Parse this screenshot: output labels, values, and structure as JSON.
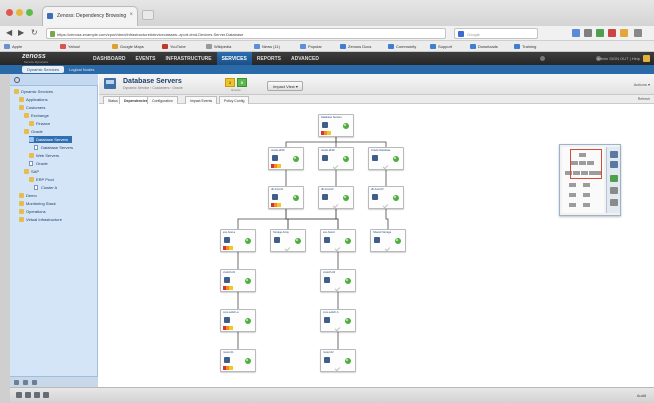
{
  "browser": {
    "tab_title": "Zenoss: Dependency Browsing",
    "tab_close": "×",
    "url": "https://zenoss.example.com/zport/dmd/infrastructure#deviceclasses:.zport.dmd.Devices.Server.Database",
    "search_placeholder": "Google",
    "back": "◀",
    "forward": "▶",
    "reload": "↻"
  },
  "bookmarks": [
    "Apple",
    "Yahoo!",
    "Google Maps",
    "YouTube",
    "Wikipedia",
    "News (11)",
    "Popular",
    "Zenoss Docs",
    "Community",
    "Support",
    "Downloads",
    "Training"
  ],
  "app": {
    "logo": "zenoss",
    "logo_sub": "Service Dynamics",
    "nav": [
      "DASHBOARD",
      "EVENTS",
      "INFRASTRUCTURE",
      "SERVICES",
      "REPORTS",
      "ADVANCED"
    ],
    "active_nav": 3,
    "head_right": "admin  SIGN OUT  |  Help",
    "subtabs": [
      "Dynamic Services",
      "Logical Nodes"
    ]
  },
  "tree": {
    "items": [
      {
        "label": "Dynamic Services",
        "level": 0,
        "type": "folder"
      },
      {
        "label": "Applications",
        "level": 1,
        "type": "folder"
      },
      {
        "label": "Customers",
        "level": 1,
        "type": "folder"
      },
      {
        "label": "Exchange",
        "level": 2,
        "type": "folder"
      },
      {
        "label": "Finance",
        "level": 3,
        "type": "folder"
      },
      {
        "label": "Oracle",
        "level": 2,
        "type": "folder"
      },
      {
        "label": "Database Servers",
        "level": 3,
        "type": "folder",
        "selected": true
      },
      {
        "label": "Database Servers",
        "level": 4,
        "type": "doc"
      },
      {
        "label": "Web Servers",
        "level": 3,
        "type": "folder"
      },
      {
        "label": "Oracle",
        "level": 3,
        "type": "doc"
      },
      {
        "label": "SAP",
        "level": 2,
        "type": "folder"
      },
      {
        "label": "ERP Prod",
        "level": 3,
        "type": "folder"
      },
      {
        "label": "Cluster A",
        "level": 4,
        "type": "doc"
      },
      {
        "label": "Demo",
        "level": 1,
        "type": "folder"
      },
      {
        "label": "Monitoring Stack",
        "level": 1,
        "type": "folder"
      },
      {
        "label": "Operations",
        "level": 1,
        "type": "folder"
      },
      {
        "label": "Virtual Infrastructure",
        "level": 1,
        "type": "folder"
      }
    ]
  },
  "main": {
    "title": "Database Servers",
    "subtitle": "Dynamic Service › Customers › Oracle",
    "sev_yellow": "1",
    "sev_green": "0",
    "sev_label": "Events",
    "impact_button": "Impact View ▾",
    "right_link": "Actions ▾",
    "tabs": [
      "Status",
      "Dependencies",
      "Configuration",
      "Impact Events",
      "Policy Config"
    ],
    "active_tab": 1,
    "tabs_right": "Refresh"
  },
  "graph_nodes": [
    {
      "label": "Database Servers",
      "icon": "service-icon",
      "status": "green",
      "bars": true
    },
    {
      "label": "oracle-db01",
      "icon": "database-icon",
      "status": "green",
      "bars": true
    },
    {
      "label": "oracle-db02",
      "icon": "database-icon",
      "status": "green",
      "bars": false
    },
    {
      "label": "Oracle Database",
      "icon": "database-icon",
      "status": "green",
      "bars": false
    },
    {
      "label": "db-host-01",
      "icon": "server-icon",
      "status": "green",
      "bars": true
    },
    {
      "label": "db-host-02",
      "icon": "server-icon",
      "status": "green",
      "bars": false
    },
    {
      "label": "db-host-03",
      "icon": "server-icon",
      "status": "green",
      "bars": false
    },
    {
      "label": "esx-host-a",
      "icon": "host-icon",
      "status": "green",
      "bars": true
    },
    {
      "label": "Storage Array",
      "icon": "storage-icon",
      "status": "green",
      "bars": false
    },
    {
      "label": "esx-host-b",
      "icon": "host-icon",
      "status": "green",
      "bars": false
    },
    {
      "label": "Shared Storage",
      "icon": "storage-icon",
      "status": "green",
      "bars": false
    },
    {
      "label": "vswitch-01",
      "icon": "switch-icon",
      "status": "green",
      "bars": true
    },
    {
      "label": "vswitch-02",
      "icon": "switch-icon",
      "status": "green",
      "bars": false
    },
    {
      "label": "core-switch-a",
      "icon": "switch-icon",
      "status": "green",
      "bars": true
    },
    {
      "label": "core-switch-b",
      "icon": "switch-icon",
      "status": "green",
      "bars": false
    },
    {
      "label": "router-01",
      "icon": "router-icon",
      "status": "green",
      "bars": true
    },
    {
      "label": "router-02",
      "icon": "router-icon",
      "status": "green",
      "bars": false
    }
  ],
  "statusbar": {
    "right": "Audit"
  },
  "colors": {
    "accent": "#2f6fb3",
    "status_green": "#4fae3f",
    "sev_red": "#d9342b",
    "sev_orange": "#f08c21",
    "sev_yellow": "#f2c630"
  }
}
